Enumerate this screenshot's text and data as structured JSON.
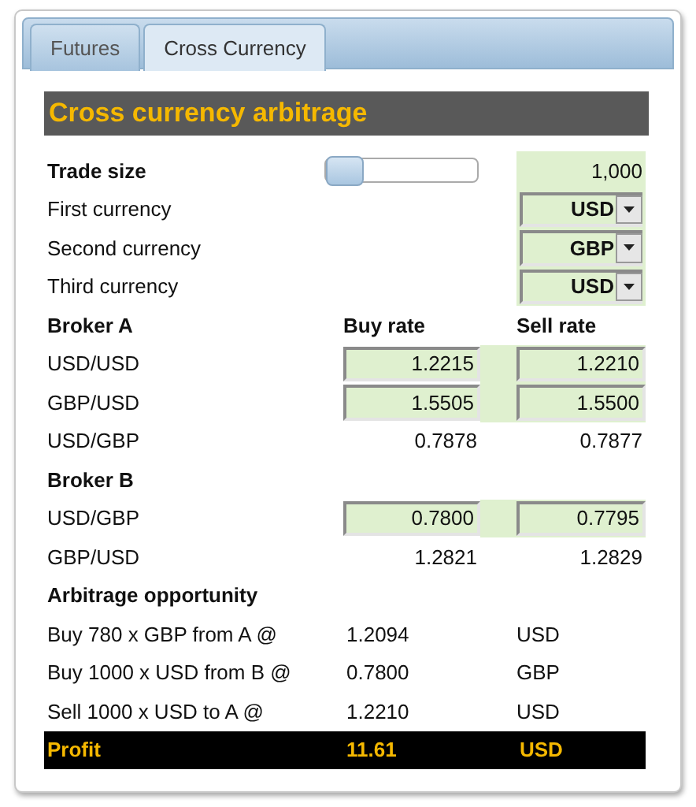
{
  "tabs": [
    {
      "label": "Futures",
      "selected": false
    },
    {
      "label": "Cross Currency",
      "selected": true
    }
  ],
  "title": "Cross currency arbitrage",
  "trade_size": {
    "label": "Trade size",
    "level": 0,
    "value": "1,000"
  },
  "currencies": [
    {
      "label": "First currency",
      "value": "USD"
    },
    {
      "label": "Second currency",
      "value": "GBP"
    },
    {
      "label": "Third currency",
      "value": "USD"
    }
  ],
  "brokers": [
    {
      "heading": "Broker A",
      "buy_header": "Buy rate",
      "sell_header": "Sell rate",
      "rows": [
        {
          "pair": "USD/USD",
          "kind": "input",
          "buy": "1.2215",
          "sell": "1.2210"
        },
        {
          "pair": "GBP/USD",
          "kind": "input",
          "buy": "1.5505",
          "sell": "1.5500"
        },
        {
          "pair": "USD/GBP",
          "kind": "computed",
          "buy": "0.7878",
          "sell": "0.7877"
        }
      ]
    },
    {
      "heading": "Broker B",
      "rows": [
        {
          "pair": "USD/GBP",
          "kind": "input",
          "buy": "0.7800",
          "sell": "0.7795"
        },
        {
          "pair": "GBP/USD",
          "kind": "computed",
          "buy": "1.2821",
          "sell": "1.2829"
        }
      ]
    }
  ],
  "arbitrage": {
    "heading": "Arbitrage opportunity",
    "rows": [
      {
        "action": "Buy 780 x GBP from A @",
        "rate": "1.2094",
        "currency": "USD"
      },
      {
        "action": "Buy 1000 x USD from B @",
        "rate": "0.7800",
        "currency": "GBP"
      },
      {
        "action": "Sell 1000 x USD to A @",
        "rate": "1.2210",
        "currency": "USD"
      }
    ],
    "profit": {
      "label": "Profit",
      "value": "11.61",
      "currency": "USD"
    }
  }
}
